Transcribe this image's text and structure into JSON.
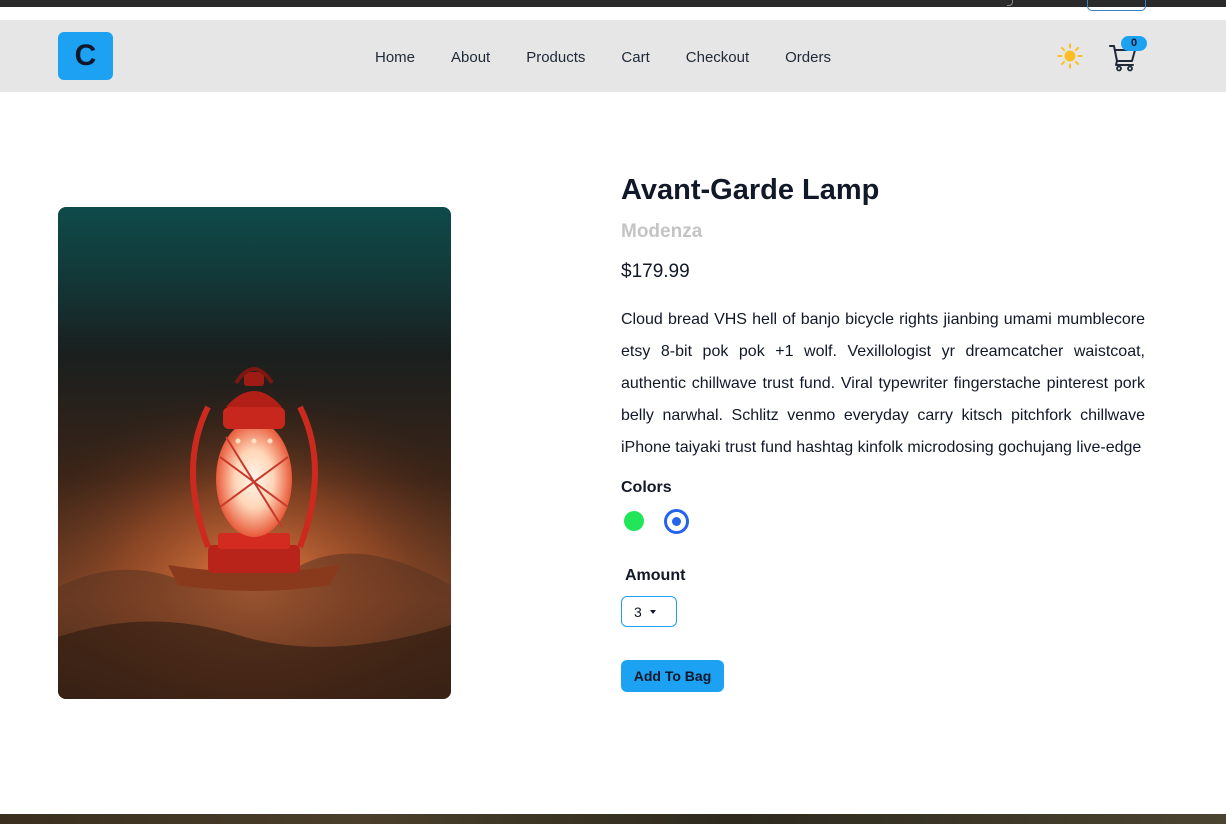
{
  "navbar": {
    "logo_text": "C",
    "links": [
      {
        "label": "Home"
      },
      {
        "label": "About"
      },
      {
        "label": "Products"
      },
      {
        "label": "Cart"
      },
      {
        "label": "Checkout"
      },
      {
        "label": "Orders"
      }
    ],
    "theme_icon": "sun-icon",
    "cart_icon": "cart-icon",
    "cart_count": "0"
  },
  "product": {
    "title": "Avant-Garde Lamp",
    "company": "Modenza",
    "price": "$179.99",
    "description": "Cloud bread VHS hell of banjo bicycle rights jianbing umami mumblecore etsy 8-bit pok pok +1 wolf. Vexillologist yr dreamcatcher waistcoat, authentic chillwave trust fund. Viral typewriter fingerstache pinterest pork belly narwhal. Schlitz venmo everyday carry kitsch pitchfork chillwave iPhone taiyaki trust fund hashtag kinfolk microdosing gochujang live-edge",
    "colors_label": "Colors",
    "colors": [
      {
        "hex": "#22e55a",
        "selected": false
      },
      {
        "hex": "#2563eb",
        "selected": true
      }
    ],
    "amount_label": "Amount",
    "amount_value": "3",
    "add_button_label": "Add To Bag",
    "image_icon": "lantern-photo"
  },
  "colors": {
    "accent": "#1da1f2",
    "navbar_bg": "#e6e6e6",
    "brand_text": "#c4c4c4"
  }
}
